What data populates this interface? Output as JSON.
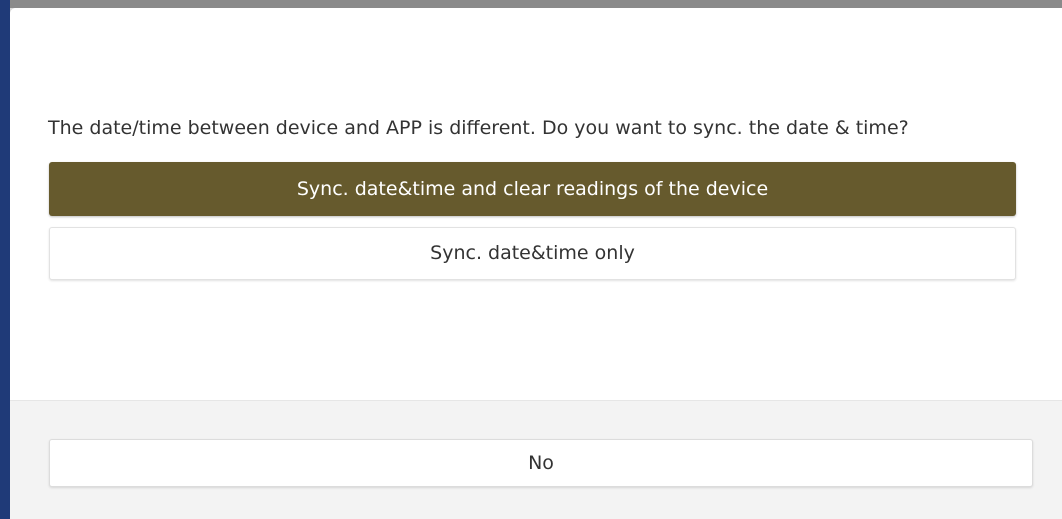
{
  "dialog": {
    "message": "The date/time between device and APP is different. Do you want to sync. the date & time?",
    "buttons": {
      "sync_and_clear": "Sync. date&time and clear readings of the device",
      "sync_only": "Sync. date&time only",
      "no": "No"
    }
  },
  "colors": {
    "primary_button": "#665a2d",
    "footer_background": "#f3f3f3",
    "backdrop_accent": "#1f3a78"
  }
}
